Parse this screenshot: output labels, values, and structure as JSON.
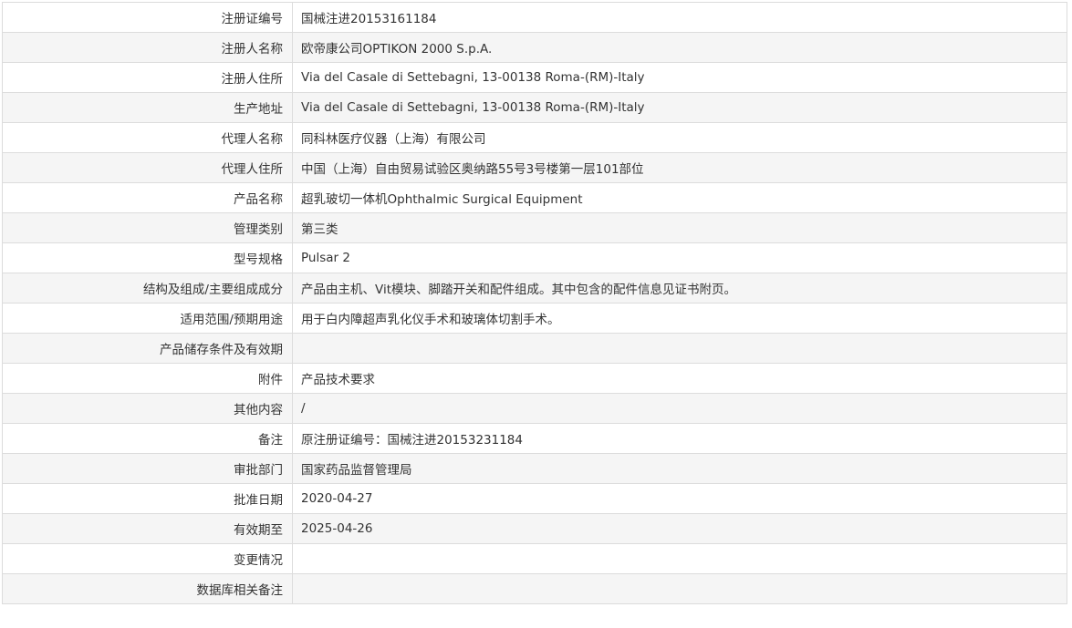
{
  "record": {
    "rows": [
      {
        "label": "注册证编号",
        "value": "国械注进20153161184"
      },
      {
        "label": "注册人名称",
        "value": "欧帝康公司OPTIKON 2000 S.p.A."
      },
      {
        "label": "注册人住所",
        "value": "Via del Casale di Settebagni, 13-00138 Roma-(RM)-Italy"
      },
      {
        "label": "生产地址",
        "value": "Via del Casale di Settebagni, 13-00138 Roma-(RM)-Italy"
      },
      {
        "label": "代理人名称",
        "value": "同科林医疗仪器（上海）有限公司"
      },
      {
        "label": "代理人住所",
        "value": "中国（上海）自由贸易试验区奥纳路55号3号楼第一层101部位"
      },
      {
        "label": "产品名称",
        "value": "超乳玻切一体机Ophthalmic Surgical Equipment"
      },
      {
        "label": "管理类别",
        "value": "第三类"
      },
      {
        "label": "型号规格",
        "value": "Pulsar 2"
      },
      {
        "label": "结构及组成/主要组成成分",
        "value": "产品由主机、Vit模块、脚踏开关和配件组成。其中包含的配件信息见证书附页。"
      },
      {
        "label": "适用范围/预期用途",
        "value": "用于白内障超声乳化仪手术和玻璃体切割手术。"
      },
      {
        "label": "产品储存条件及有效期",
        "value": ""
      },
      {
        "label": "附件",
        "value": "产品技术要求"
      },
      {
        "label": "其他内容",
        "value": "/"
      },
      {
        "label": "备注",
        "value": "原注册证编号：国械注进20153231184"
      },
      {
        "label": "审批部门",
        "value": "国家药品监督管理局"
      },
      {
        "label": "批准日期",
        "value": "2020-04-27"
      },
      {
        "label": "有效期至",
        "value": "2025-04-26"
      },
      {
        "label": "变更情况",
        "value": ""
      },
      {
        "label": "数据库相关备注",
        "value": ""
      }
    ]
  }
}
